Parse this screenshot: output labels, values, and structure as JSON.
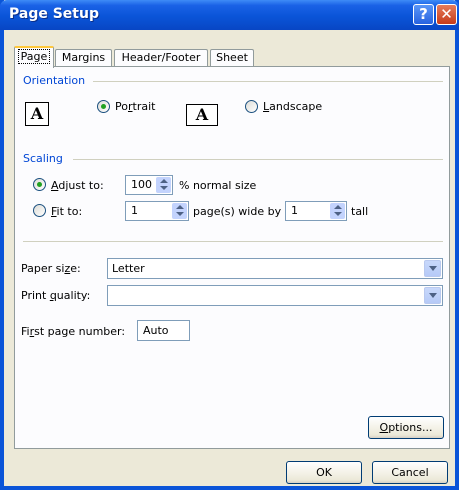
{
  "window": {
    "title": "Page Setup",
    "help_label": "?",
    "close_label": "✕"
  },
  "tabs": [
    {
      "label": "Page",
      "active": true
    },
    {
      "label": "Margins",
      "active": false
    },
    {
      "label": "Header/Footer",
      "active": false
    },
    {
      "label": "Sheet",
      "active": false
    }
  ],
  "orientation": {
    "group_label": "Orientation",
    "portrait": {
      "pre": "Po",
      "key": "r",
      "post": "trait",
      "selected": true,
      "icon_glyph": "A"
    },
    "landscape": {
      "pre": "",
      "key": "L",
      "post": "andscape",
      "selected": false,
      "icon_glyph": "A"
    }
  },
  "scaling": {
    "group_label": "Scaling",
    "adjust": {
      "pre": "",
      "key": "A",
      "post": "djust to:",
      "selected": true,
      "value": "100",
      "suffix": "% normal size"
    },
    "fit": {
      "pre": "",
      "key": "F",
      "post": "it to:",
      "selected": false,
      "pages_wide": "1",
      "middle": "page(s) wide by",
      "pages_tall": "1",
      "suffix": "tall"
    }
  },
  "paper_size": {
    "pre": "Paper si",
    "key": "z",
    "post": "e:",
    "value": "Letter"
  },
  "print_quality": {
    "pre": "Print ",
    "key": "q",
    "post": "uality:",
    "value": ""
  },
  "first_page_number": {
    "pre": "Fi",
    "key": "r",
    "post": "st page number:",
    "value": "Auto"
  },
  "buttons": {
    "options": {
      "pre": "",
      "key": "O",
      "post": "ptions..."
    },
    "ok": "OK",
    "cancel": "Cancel"
  },
  "colors": {
    "title_bar": "#0a54d8",
    "group_label": "#0046d5",
    "radio_dot": "#21a121"
  }
}
